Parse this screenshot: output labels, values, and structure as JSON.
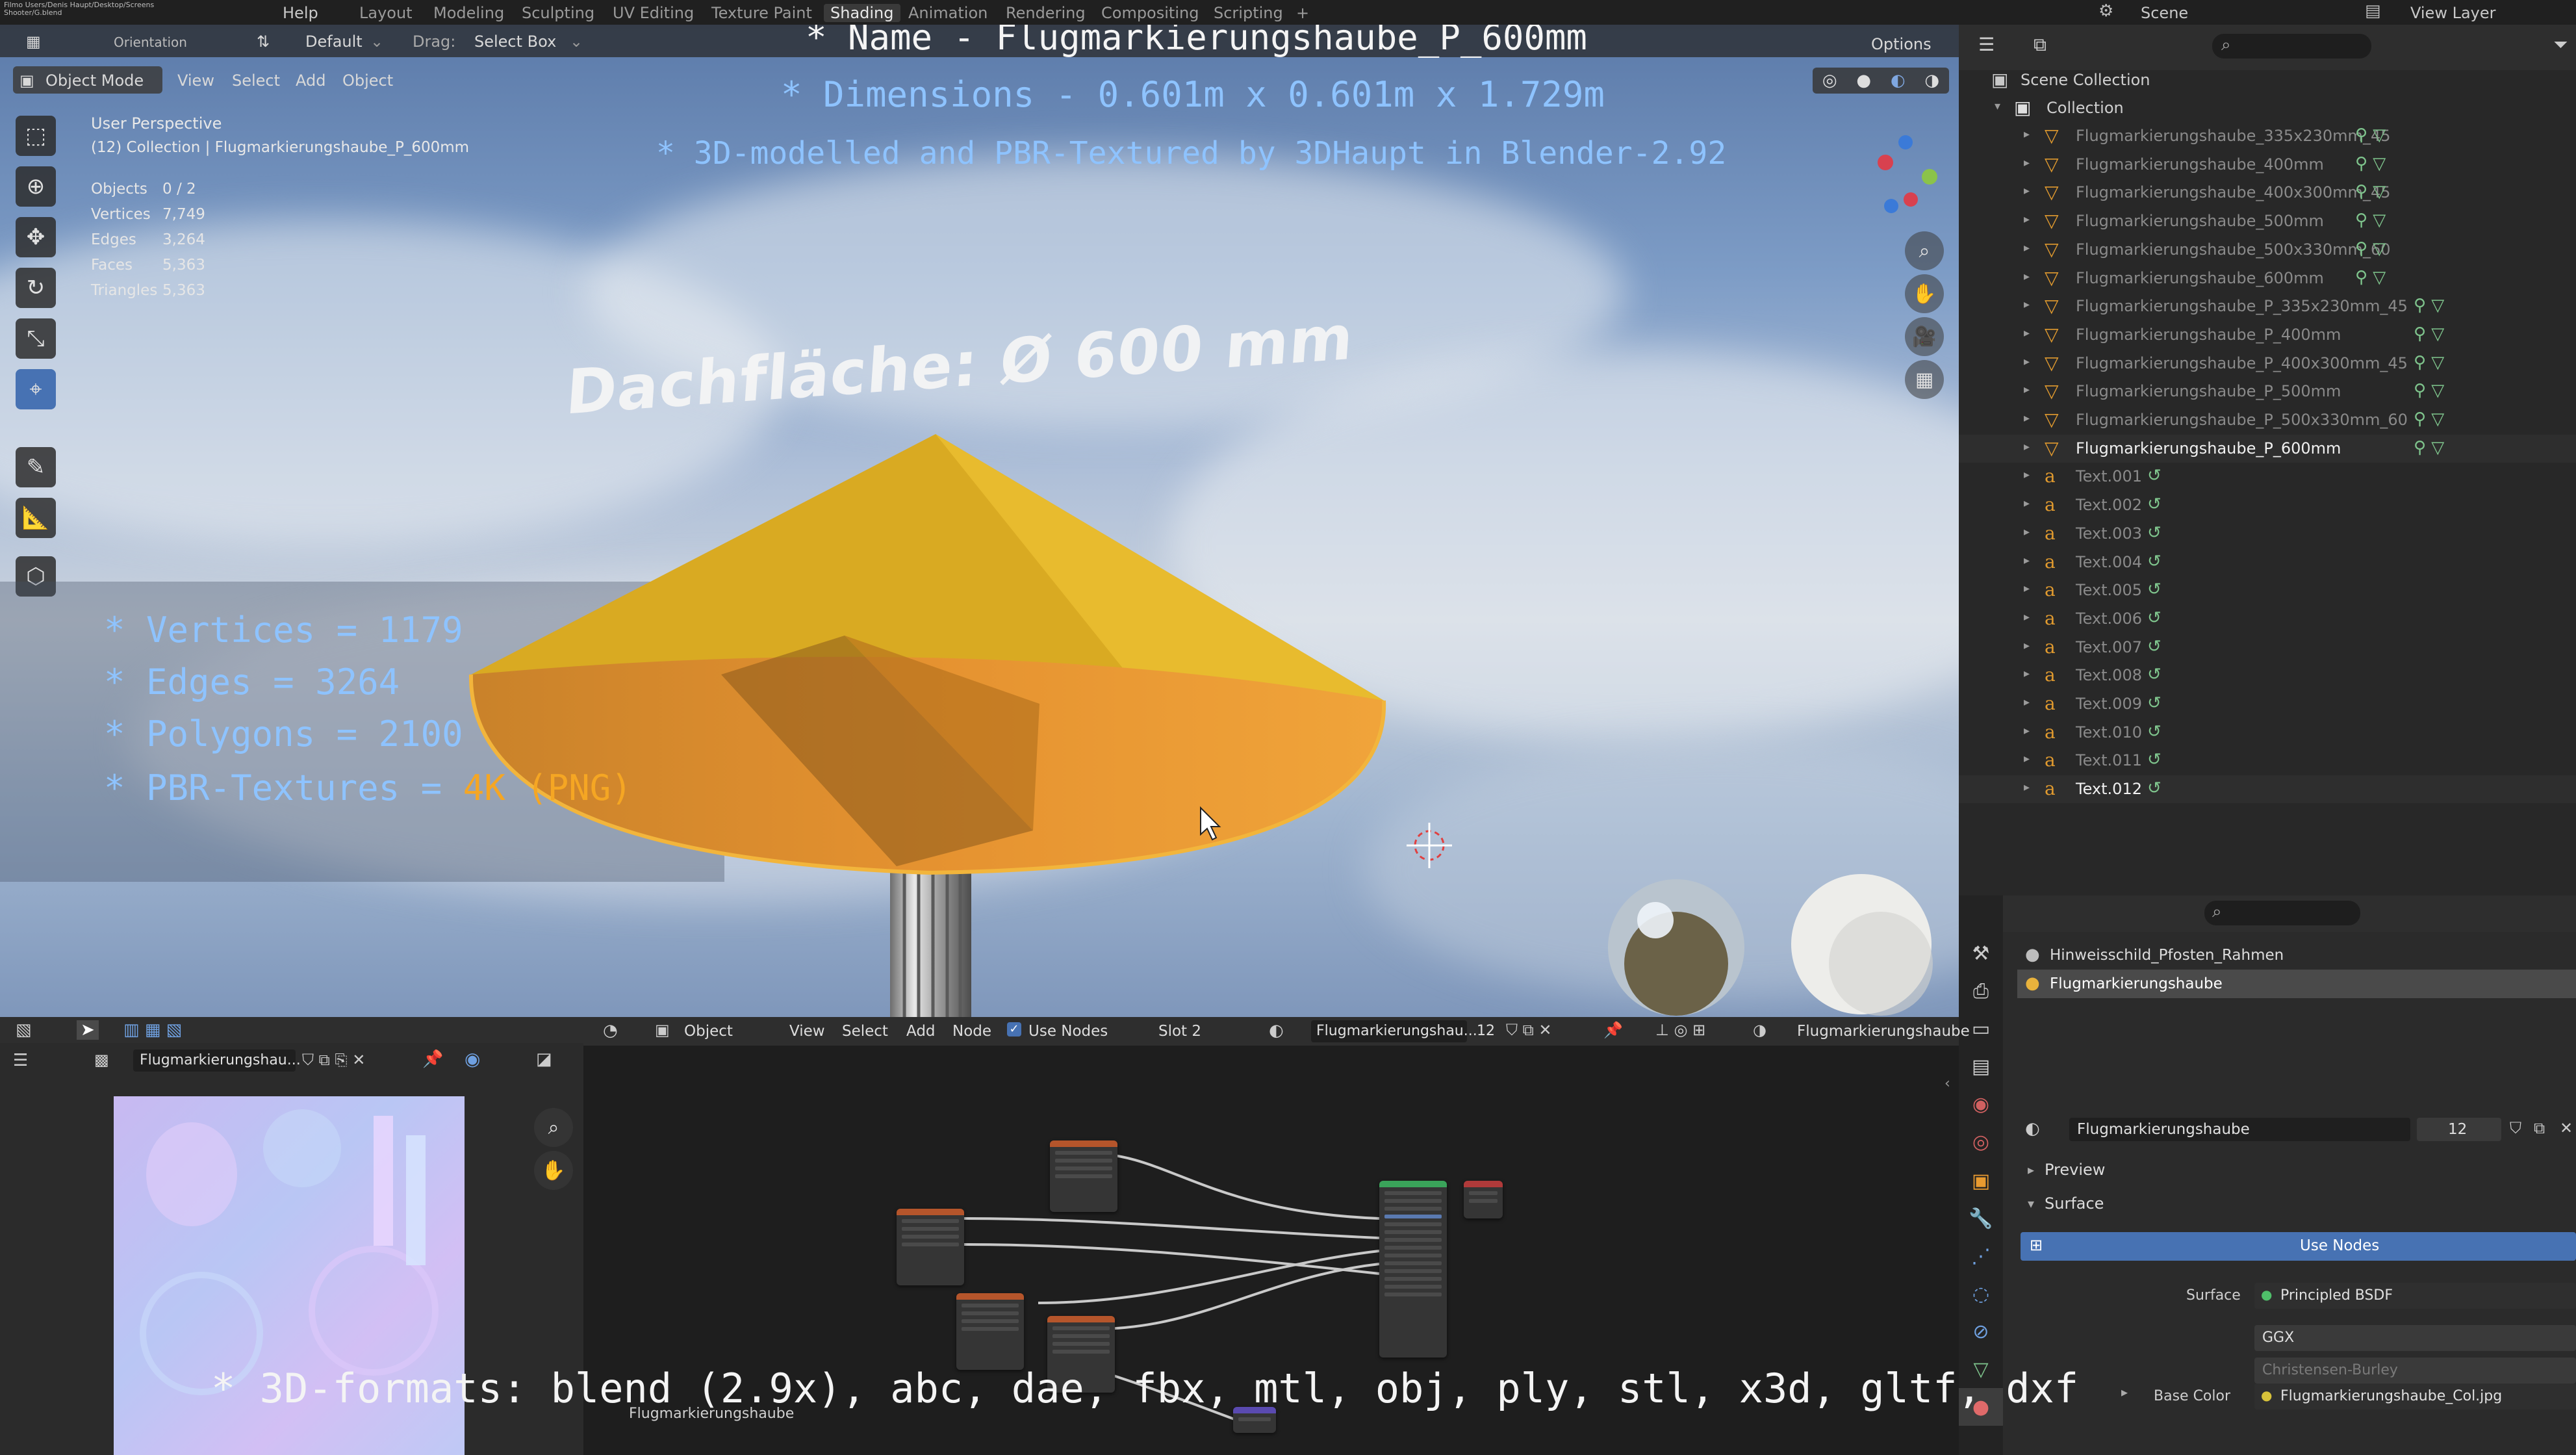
{
  "top_menu": {
    "file_info": "Filmo Users/Denis Haupt/Desktop/Screens Shooter/G.blend",
    "menus": [
      "Help"
    ],
    "workspaces": [
      "Layout",
      "Modeling",
      "Sculpting",
      "UV Editing",
      "Texture Paint",
      "Shading",
      "Animation",
      "Rendering",
      "Compositing",
      "Scripting"
    ],
    "active_workspace": "Shading",
    "scene_label": "Scene",
    "view_layer_label": "View Layer"
  },
  "overlay": {
    "name_line": "* Name - Flugmarkierungshaube_P_600mm",
    "dimensions_line": "* Dimensions -  0.601m x 0.601m x 1.729m",
    "modelled_line": "* 3D-modelled and PBR-Textured by 3DHaupt in Blender-2.92",
    "vertices_line": "* Vertices = 1179",
    "edges_line": "* Edges = 3264",
    "polygons_line": "* Polygons = 2100",
    "textures_prefix": "* PBR-Textures = ",
    "textures_value": "4K (PNG)",
    "formats_line": "* 3D-formats: blend (2.9x), abc, dae, fbx, mtl, obj, ply, stl, x3d, gltf, dxf",
    "scene_text": "Dachfläche:  Ø 600 mm"
  },
  "viewport": {
    "orientation_label": "Orientation",
    "default_label": "Default",
    "drag_label": "Drag:",
    "select_box": "Select Box",
    "options_label": "Options",
    "mode": "Object Mode",
    "menu": [
      "View",
      "Select",
      "Add",
      "Object"
    ],
    "perspective": "User Perspective",
    "collection_info": "(12) Collection | Flugmarkierungshaube_P_600mm",
    "stats": [
      {
        "label": "Objects",
        "value": "0 / 2"
      },
      {
        "label": "Vertices",
        "value": "7,749"
      },
      {
        "label": "Edges",
        "value": "3,264"
      },
      {
        "label": "Faces",
        "value": "5,363"
      },
      {
        "label": "Triangles",
        "value": "5,363"
      }
    ]
  },
  "outliner": {
    "root": "Scene Collection",
    "collection": "Collection",
    "items": [
      {
        "name": "Flugmarkierungshaube_335x230mm_45",
        "kind": "mesh",
        "dim": true
      },
      {
        "name": "Flugmarkierungshaube_400mm",
        "kind": "mesh",
        "dim": true
      },
      {
        "name": "Flugmarkierungshaube_400x300mm_45",
        "kind": "mesh",
        "dim": true
      },
      {
        "name": "Flugmarkierungshaube_500mm",
        "kind": "mesh",
        "dim": true
      },
      {
        "name": "Flugmarkierungshaube_500x330mm_60",
        "kind": "mesh",
        "dim": true
      },
      {
        "name": "Flugmarkierungshaube_600mm",
        "kind": "mesh",
        "dim": true
      },
      {
        "name": "Flugmarkierungshaube_P_335x230mm_45",
        "kind": "mesh",
        "dim": true
      },
      {
        "name": "Flugmarkierungshaube_P_400mm",
        "kind": "mesh",
        "dim": true
      },
      {
        "name": "Flugmarkierungshaube_P_400x300mm_45",
        "kind": "mesh",
        "dim": true
      },
      {
        "name": "Flugmarkierungshaube_P_500mm",
        "kind": "mesh",
        "dim": true
      },
      {
        "name": "Flugmarkierungshaube_P_500x330mm_60",
        "kind": "mesh",
        "dim": true
      },
      {
        "name": "Flugmarkierungshaube_P_600mm",
        "kind": "mesh",
        "dim": false
      },
      {
        "name": "Text.001",
        "kind": "text",
        "dim": true
      },
      {
        "name": "Text.002",
        "kind": "text",
        "dim": true
      },
      {
        "name": "Text.003",
        "kind": "text",
        "dim": true
      },
      {
        "name": "Text.004",
        "kind": "text",
        "dim": true
      },
      {
        "name": "Text.005",
        "kind": "text",
        "dim": true
      },
      {
        "name": "Text.006",
        "kind": "text",
        "dim": true
      },
      {
        "name": "Text.007",
        "kind": "text",
        "dim": true
      },
      {
        "name": "Text.008",
        "kind": "text",
        "dim": true
      },
      {
        "name": "Text.009",
        "kind": "text",
        "dim": true
      },
      {
        "name": "Text.010",
        "kind": "text",
        "dim": true
      },
      {
        "name": "Text.011",
        "kind": "text",
        "dim": true
      },
      {
        "name": "Text.012",
        "kind": "text",
        "dim": false
      }
    ]
  },
  "properties": {
    "materials": [
      "Hinweisschild_Pfosten_Rahmen",
      "Flugmarkierungshaube"
    ],
    "material_name": "Flugmarkierungshaube",
    "user_count": "12",
    "preview_label": "Preview",
    "surface_label": "Surface",
    "use_nodes_button": "Use Nodes",
    "surface_field_label": "Surface",
    "surface_value": "Principled BSDF",
    "distribution": "GGX",
    "subsurface_partial": "Christensen-Burley",
    "base_color_label": "Base Color",
    "base_color_value": "Flugmarkierungshaube_Col.jpg"
  },
  "image_editor": {
    "image_name": "Flugmarkierungshau..."
  },
  "node_editor": {
    "object_label": "Object",
    "menu": [
      "View",
      "Select",
      "Add",
      "Node"
    ],
    "use_nodes": "Use Nodes",
    "slot": "Slot 2",
    "material": "Flugmarkierungshau...",
    "users": "12",
    "breadcrumb": "Flugmarkierungshaube",
    "footer_label": "Flugmarkierungshaube"
  },
  "colors": {
    "overlay_white": "#f4f4f4",
    "overlay_blue": "#8ec3ff",
    "overlay_orange": "#f5a623",
    "accent_blue": "#4772b3",
    "cone_yellow": "#e0ad2a"
  }
}
